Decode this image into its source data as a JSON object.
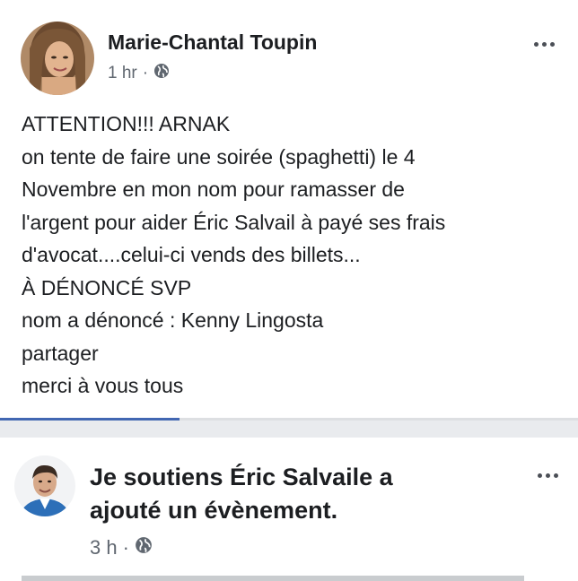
{
  "post1": {
    "author": "Marie-Chantal Toupin",
    "time": "1 hr",
    "separator": "·",
    "privacy_icon": "globe-icon",
    "more_icon": "more-options-icon",
    "lines": [
      "ATTENTION!!!  ARNAK",
      "on tente de faire une soirée (spaghetti) le 4",
      "Novembre en mon nom pour ramasser de",
      "l'argent pour aider Éric Salvail à payé ses frais",
      "d'avocat....celui-ci vends des billets...",
      "À DÉNONCÉ SVP",
      "nom a dénoncé : Kenny Lingosta",
      "partager",
      "merci à vous tous"
    ]
  },
  "post2": {
    "title_line1": "Je soutiens Éric Salvaile a",
    "title_line2": "ajouté un évènement.",
    "time": "3 h",
    "separator": "·",
    "privacy_icon": "globe-icon",
    "more_icon": "more-options-icon"
  },
  "colors": {
    "background": "#e9ebee",
    "card": "#ffffff",
    "text": "#1c1e21",
    "meta": "#606770",
    "accent": "#4267b2"
  }
}
